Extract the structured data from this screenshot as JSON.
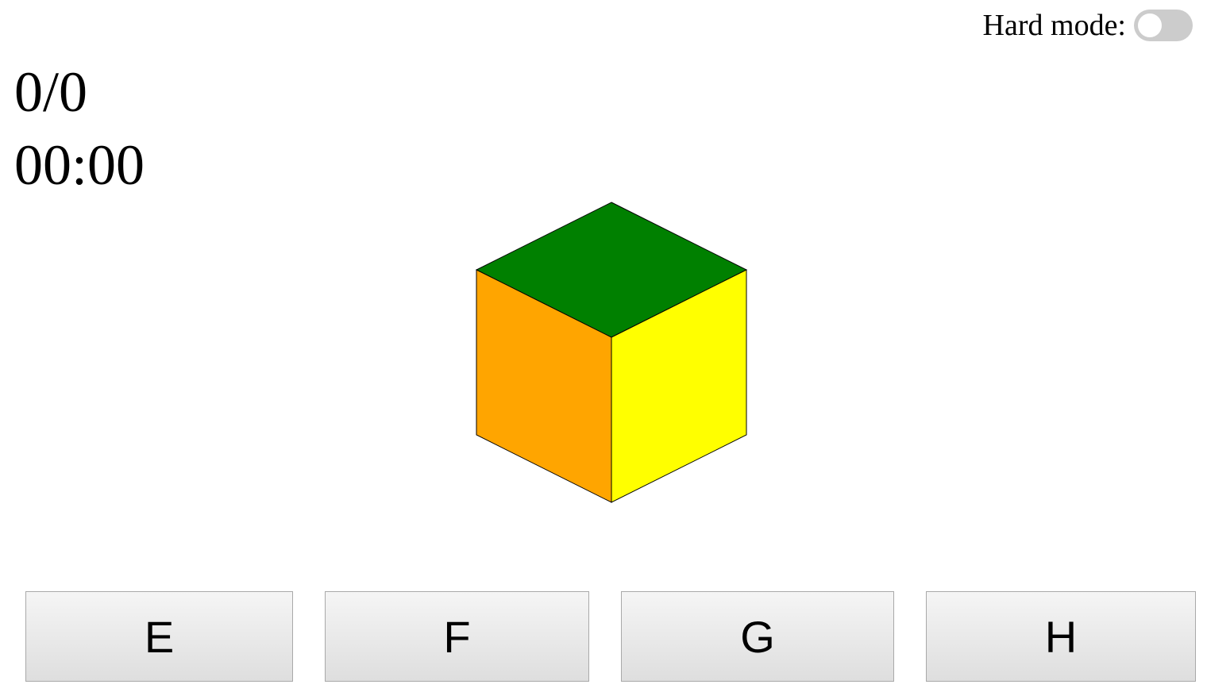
{
  "hard_mode": {
    "label": "Hard mode:",
    "enabled": false
  },
  "stats": {
    "score": "0/0",
    "timer": "00:00"
  },
  "cube": {
    "top_color": "#008000",
    "left_color": "#FFA500",
    "right_color": "#FFFF00"
  },
  "choices": [
    {
      "label": "E"
    },
    {
      "label": "F"
    },
    {
      "label": "G"
    },
    {
      "label": "H"
    }
  ]
}
